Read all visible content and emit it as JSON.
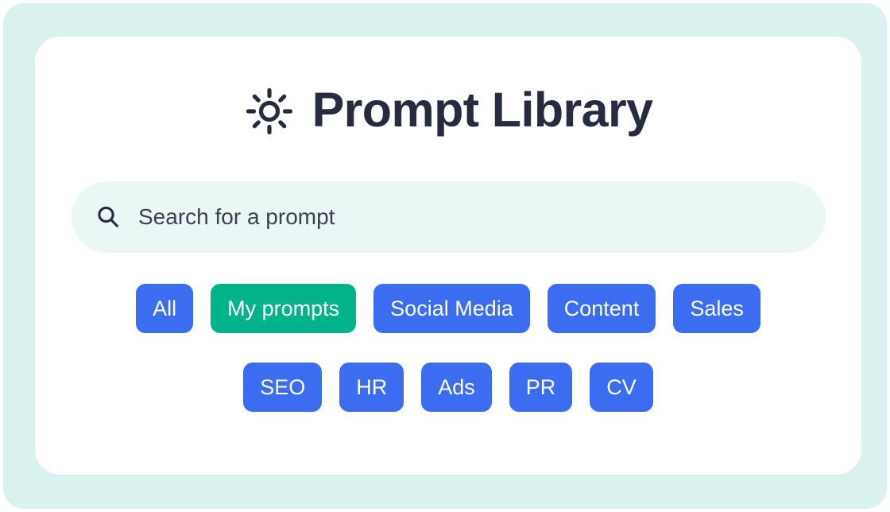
{
  "theme": {
    "outer_background": "#d9f2f0",
    "card_background": "#ffffff",
    "search_background": "#eaf7f4",
    "chip_blue": "#3c6df0",
    "chip_green_active": "#00b38a",
    "title_color": "#262b40",
    "chip_text_color": "#ffffff"
  },
  "header": {
    "icon": "sun-icon",
    "title": "Prompt Library"
  },
  "search": {
    "icon": "search-icon",
    "placeholder": "Search for a prompt",
    "value": ""
  },
  "filters": {
    "rows": [
      [
        {
          "label": "All",
          "active": false
        },
        {
          "label": "My prompts",
          "active": true
        },
        {
          "label": "Social Media",
          "active": false
        },
        {
          "label": "Content",
          "active": false
        },
        {
          "label": "Sales",
          "active": false
        }
      ],
      [
        {
          "label": "SEO",
          "active": false
        },
        {
          "label": "HR",
          "active": false
        },
        {
          "label": "Ads",
          "active": false
        },
        {
          "label": "PR",
          "active": false
        },
        {
          "label": "CV",
          "active": false
        }
      ]
    ]
  }
}
